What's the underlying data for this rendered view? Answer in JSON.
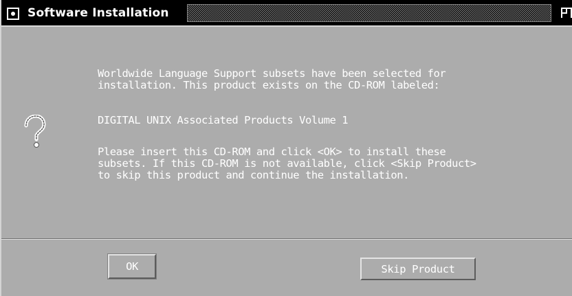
{
  "window": {
    "title": "Software Installation"
  },
  "icons": {
    "menu": "window-menu-icon",
    "resize": "resize-icon",
    "dialog": "question-mark-icon"
  },
  "message": {
    "paragraph_1": "Worldwide Language Support subsets have been selected for\ninstallation. This product exists on the CD-ROM labeled:",
    "paragraph_2": "DIGITAL UNIX Associated Products Volume 1",
    "paragraph_3": "Please insert this CD-ROM and click <OK> to install these\nsubsets. If this CD-ROM is not available, click <Skip Product>\nto skip this product and continue the installation."
  },
  "buttons": {
    "ok_label": "OK",
    "skip_label": "Skip Product"
  }
}
